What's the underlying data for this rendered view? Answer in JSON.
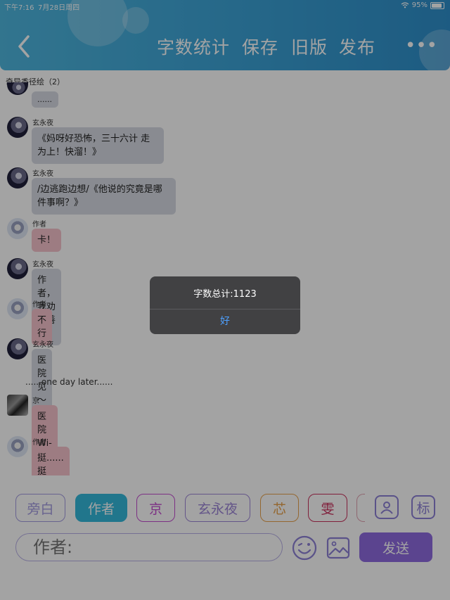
{
  "status": {
    "time": "下午7:16",
    "date": "7月28日周四",
    "battery": "95%",
    "battery_level": 0.95
  },
  "header": {
    "word_count": "字数统计",
    "save": "保存",
    "old_version": "旧版",
    "publish": "发布",
    "more": "•••"
  },
  "room": {
    "title": "奇异香径绘（2）"
  },
  "messages": [
    {
      "text": "......"
    },
    {
      "name": "玄永夜",
      "text": "《妈呀好恐怖，三十六计 走为上！快溜！》"
    },
    {
      "name": "玄永夜",
      "text": "/边逃跑边想/《他说的究竟是哪件事啊？》"
    },
    {
      "name": "作者",
      "text": "卡！"
    },
    {
      "name": "玄永夜",
      "text": "作者，我劝你善良"
    },
    {
      "name": "作者",
      "text": "不行"
    },
    {
      "name": "玄永夜",
      "text": "医院见～"
    },
    {
      "narration": "......one day later......"
    },
    {
      "name": "京",
      "text": "医院 Wi-Fi好吗?"
    },
    {
      "name": "作者",
      "text": "挺......挺好......好的"
    }
  ],
  "roles": [
    {
      "label": "旁白",
      "color": "#a39be0"
    },
    {
      "label": "作者",
      "color": "#35b9dc"
    },
    {
      "label": "京",
      "color": "#c34bcf"
    },
    {
      "label": "玄永夜",
      "color": "#9d86d6"
    },
    {
      "label": "芯",
      "color": "#e8a24c"
    },
    {
      "label": "雯",
      "color": "#c8305c"
    }
  ],
  "tools": {
    "tag": "标"
  },
  "input": {
    "placeholder": "作者:"
  },
  "send": {
    "label": "发送"
  },
  "alert": {
    "message": "字数总计:1123",
    "ok": "好"
  }
}
